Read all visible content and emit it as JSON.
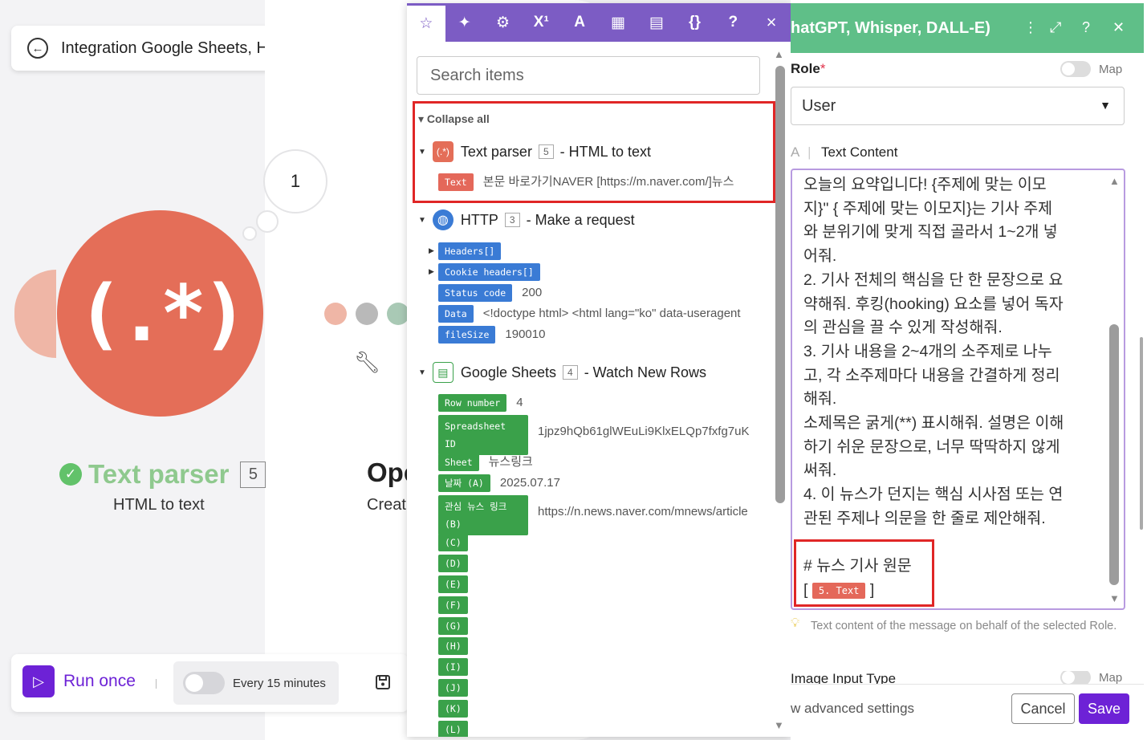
{
  "canvas": {
    "back_title": "Integration Google Sheets, HTTP",
    "bubble_count": "1",
    "module_name": "Text parser",
    "module_number": "5",
    "module_sub": "HTML to text",
    "next_module_name": "Ope",
    "next_module_sub": "Creat",
    "module_color": "#e46e58",
    "connector_colors": [
      "#efb6a6",
      "#b9b9b9",
      "#a9c9b5"
    ]
  },
  "bottom_bar": {
    "run_label": "Run once",
    "schedule_label": "Every 15 minutes"
  },
  "mapper": {
    "tabs": [
      "star-icon",
      "sparkle-icon",
      "gear-icon",
      "superscript-icon",
      "text-icon",
      "calendar-icon",
      "table-icon",
      "braces-icon",
      "help-icon",
      "close-icon"
    ],
    "tab_glyphs": [
      "☆",
      "✦",
      "⚙",
      "X¹",
      "A",
      "▦",
      "▤",
      "{}",
      "?",
      "×"
    ],
    "search_placeholder": "Search items",
    "collapse_all": "Collapse all",
    "groups": [
      {
        "name": "Text parser",
        "number": "5",
        "desc": "- HTML to text",
        "items": [
          {
            "tag": "Text",
            "value": "본문 바로가기NAVER [https://m.naver.com/]뉴스"
          }
        ]
      },
      {
        "name": "HTTP",
        "number": "3",
        "desc": "- Make a request",
        "items": [
          {
            "tag": "Headers[]",
            "value": ""
          },
          {
            "tag": "Cookie headers[]",
            "value": ""
          },
          {
            "tag": "Status code",
            "value": "200"
          },
          {
            "tag": "Data",
            "value": "<!doctype html> <html lang=\"ko\" data-useragent"
          },
          {
            "tag": "fileSize",
            "value": "190010"
          }
        ]
      },
      {
        "name": "Google Sheets",
        "number": "4",
        "desc": "- Watch New Rows",
        "items": [
          {
            "tag": "Row number",
            "value": "4"
          },
          {
            "tag": "Spreadsheet ID",
            "value": "1jpz9hQb61glWEuLi9KlxELQp7fxfg7uK"
          },
          {
            "tag": "Sheet",
            "value": "뉴스링크"
          },
          {
            "tag": "날짜 (A)",
            "value": "2025.07.17"
          },
          {
            "tag": "관심 뉴스 링크 (B)",
            "value": "https://n.news.naver.com/mnews/article"
          },
          {
            "tag": "(C)",
            "value": ""
          },
          {
            "tag": "(D)",
            "value": ""
          },
          {
            "tag": "(E)",
            "value": ""
          },
          {
            "tag": "(F)",
            "value": ""
          },
          {
            "tag": "(G)",
            "value": ""
          },
          {
            "tag": "(H)",
            "value": ""
          },
          {
            "tag": "(I)",
            "value": ""
          },
          {
            "tag": "(J)",
            "value": ""
          },
          {
            "tag": "(K)",
            "value": ""
          },
          {
            "tag": "(L)",
            "value": ""
          }
        ]
      }
    ]
  },
  "panel": {
    "title": "hatGPT, Whisper, DALL-E)",
    "role_label": "Role",
    "required_mark": "*",
    "map_label": "Map",
    "role_value": "User",
    "text_content_label": "Text Content",
    "text_content_prefix": "A",
    "editor_lines": [
      "오늘의 요약입니다! {주제에 맞는 이모",
      "지}\" { 주제에 맞는 이모지}는 기사 주제",
      "와 분위기에 맞게 직접 골라서 1~2개 넣",
      "어줘.",
      "2. 기사 전체의 핵심을 단 한 문장으로 요",
      "약해줘. 후킹(hooking) 요소를 넣어 독자",
      "의 관심을 끌 수 있게 작성해줘.",
      "3. 기사 내용을 2~4개의 소주제로 나누",
      "고, 각 소주제마다 내용을 간결하게 정리",
      "해줘.",
      "소제목은 굵게(**) 표시해줘. 설명은 이해",
      "하기 쉬운 문장으로, 너무 딱딱하지 않게",
      "써줘.",
      "4. 이 뉴스가 던지는 핵심 시사점 또는 연",
      "관된 주제나 의문을 한 줄로 제안해줘."
    ],
    "news_heading": "# 뉴스 기사 원문",
    "bracket_open": "[",
    "bracket_close": "]",
    "mapped_pill": "5. Text",
    "hint": "Text content of the message on behalf of the selected Role.",
    "image_input_label": "Image Input Type",
    "advanced_label": "w advanced settings",
    "cancel_label": "Cancel",
    "save_label": "Save",
    "accent_color": "#6d22d6",
    "header_color": "#5fbf88"
  }
}
